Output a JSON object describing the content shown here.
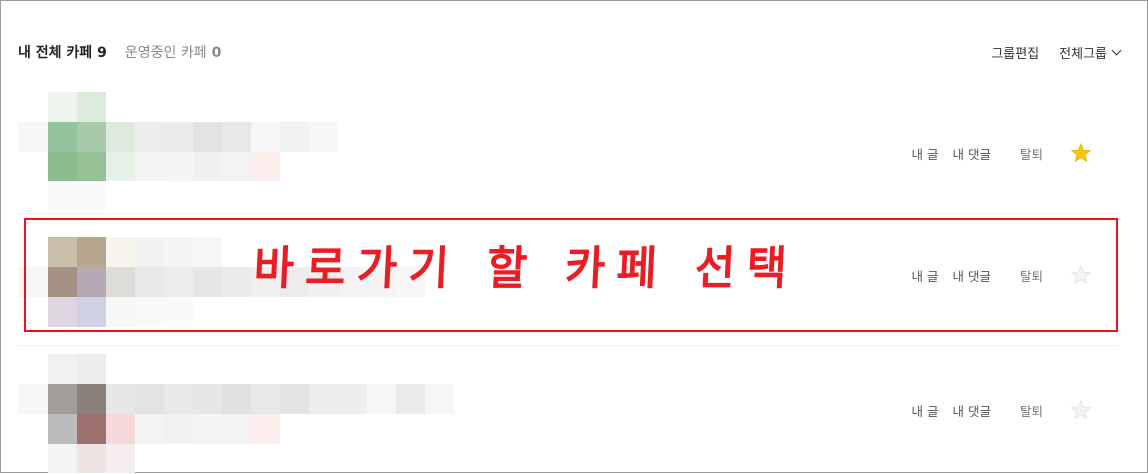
{
  "header": {
    "title": "내 전체 카페",
    "title_count": "9",
    "managed_label": "운영중인 카페",
    "managed_count": "0",
    "edit_group_label": "그룹편집",
    "group_filter_label": "전체그룹"
  },
  "cafes": [
    {
      "my_posts_label": "내 글",
      "my_comments_label": "내 댓글",
      "leave_label": "탈퇴",
      "favorite": true
    },
    {
      "my_posts_label": "내 글",
      "my_comments_label": "내 댓글",
      "leave_label": "탈퇴",
      "favorite": false
    },
    {
      "my_posts_label": "내 글",
      "my_comments_label": "내 댓글",
      "leave_label": "탈퇴",
      "favorite": false
    }
  ],
  "annotation": {
    "text": "바로가기 할 카페 선택",
    "color": "#e8141c"
  },
  "colors": {
    "star_on": "#f5c518",
    "star_off": "#e2e2e2"
  }
}
